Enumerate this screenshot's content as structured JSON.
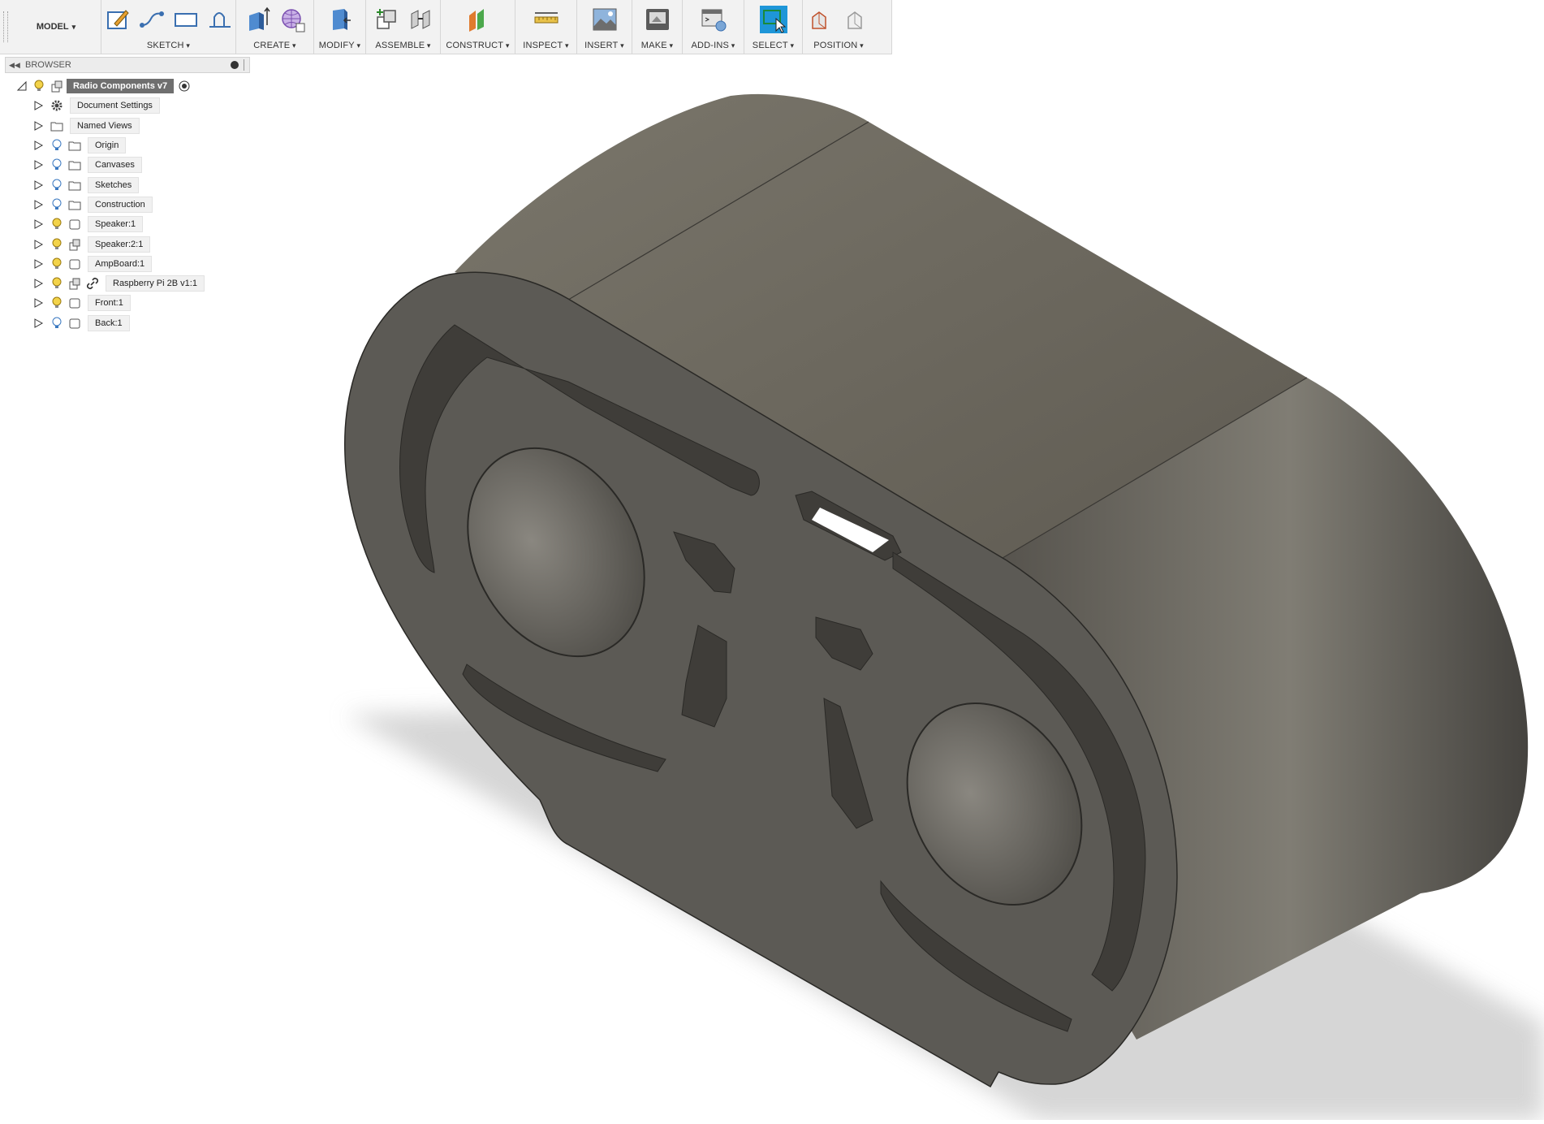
{
  "toolbar": {
    "workspace": "MODEL",
    "groups": {
      "sketch": "SKETCH",
      "create": "CREATE",
      "modify": "MODIFY",
      "assemble": "ASSEMBLE",
      "construct": "CONSTRUCT",
      "inspect": "INSPECT",
      "insert": "INSERT",
      "make": "MAKE",
      "addins": "ADD-INS",
      "select": "SELECT",
      "position": "POSITION"
    }
  },
  "browser": {
    "title": "BROWSER",
    "root": "Radio Components v7",
    "items": [
      "Document Settings",
      "Named Views",
      "Origin",
      "Canvases",
      "Sketches",
      "Construction",
      "Speaker:1",
      "Speaker:2:1",
      "AmpBoard:1",
      "Raspberry Pi 2B v1:1",
      "Front:1",
      "Back:1"
    ]
  },
  "colors": {
    "accent": "#1e96d8",
    "model_dark": "#4f4d49",
    "model_top": "#6f6b61"
  }
}
